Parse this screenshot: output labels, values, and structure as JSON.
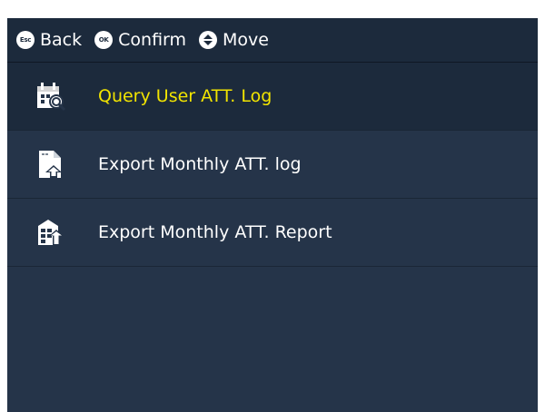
{
  "topbar": {
    "hints": [
      {
        "key": "Esc",
        "label": "Back"
      },
      {
        "key": "OK",
        "label": "Confirm"
      },
      {
        "key": "updown-icon",
        "label": "Move"
      }
    ]
  },
  "menu": {
    "items": [
      {
        "label": "Query User ATT. Log",
        "icon": "calendar-search-icon",
        "selected": true
      },
      {
        "label": "Export Monthly ATT. log",
        "icon": "document-upload-icon",
        "selected": false
      },
      {
        "label": "Export Monthly ATT. Report",
        "icon": "report-export-icon",
        "selected": false
      }
    ]
  },
  "colors": {
    "background": "#253449",
    "topbar": "#1c2a3c",
    "selected_text": "#f2e400",
    "text": "#ffffff"
  }
}
